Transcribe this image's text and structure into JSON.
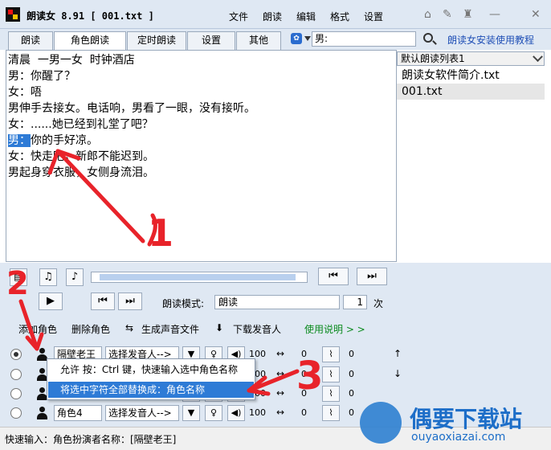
{
  "app": {
    "title": "朗读女 8.91  [ 001.txt ]"
  },
  "menu": [
    "文件",
    "朗读",
    "编辑",
    "格式",
    "设置"
  ],
  "window_icons": [
    "home-icon",
    "tools-icon",
    "minimize-icon",
    "close-icon"
  ],
  "tabs": [
    {
      "label": "朗读",
      "active": false
    },
    {
      "label": "角色朗读",
      "active": true
    },
    {
      "label": "定时朗读",
      "active": false
    },
    {
      "label": "设置",
      "active": false
    },
    {
      "label": "其他",
      "active": false
    }
  ],
  "search": {
    "value": "男:"
  },
  "tutorial_link": "朗读女安装使用教程",
  "editor": {
    "lines": [
      "清晨  一男一女  时钟酒店",
      "男：你醒了？",
      "女：唔",
      "男伸手去接女。电话响，男看了一眼，没有接听。",
      "女：......她已经到礼堂了吧？",
      "",
      "女：快走吧，新郎不能迟到。",
      "男起身穿衣服，女侧身流泪。"
    ],
    "selected_prefix": "男：",
    "selected_rest": "你的手好凉。"
  },
  "playlist": {
    "selected_list": "默认朗读列表1",
    "items": [
      "朗读女软件简介.txt",
      "001.txt"
    ]
  },
  "controls": {
    "mode_label": "朗读模式:",
    "mode_value": "朗读",
    "repeat_count": "1",
    "repeat_unit": "次"
  },
  "toolbar": {
    "add_role": "添加角色",
    "delete_role": "删除角色",
    "generate_audio": "生成声音文件",
    "download_voice": "下载发音人",
    "usage_help": "使用说明 > >"
  },
  "roles": [
    {
      "name": "隔壁老王",
      "voice": "选择发音人-->",
      "volume": "100",
      "speed": "0",
      "pitch": "0",
      "selected": true
    },
    {
      "name": "",
      "voice": "",
      "volume": "100",
      "speed": "0",
      "pitch": "0",
      "selected": false
    },
    {
      "name": "",
      "voice": "",
      "volume": "100",
      "speed": "0",
      "pitch": "0",
      "selected": false
    },
    {
      "name": "角色4",
      "voice": "选择发音人-->",
      "volume": "100",
      "speed": "0",
      "pitch": "0",
      "selected": false
    }
  ],
  "popup": {
    "hint": "允许 按：Ctrl 键，快速输入选中角色名称",
    "action": "将选中字符全部替换成：角色名称"
  },
  "status": {
    "text": "快速输入：角色扮演者名称：[隔壁老王]"
  },
  "annotations": [
    "1",
    "2",
    "3"
  ],
  "watermark": {
    "title": "偶要下载站",
    "url": "ouyaoxiazai.com"
  }
}
